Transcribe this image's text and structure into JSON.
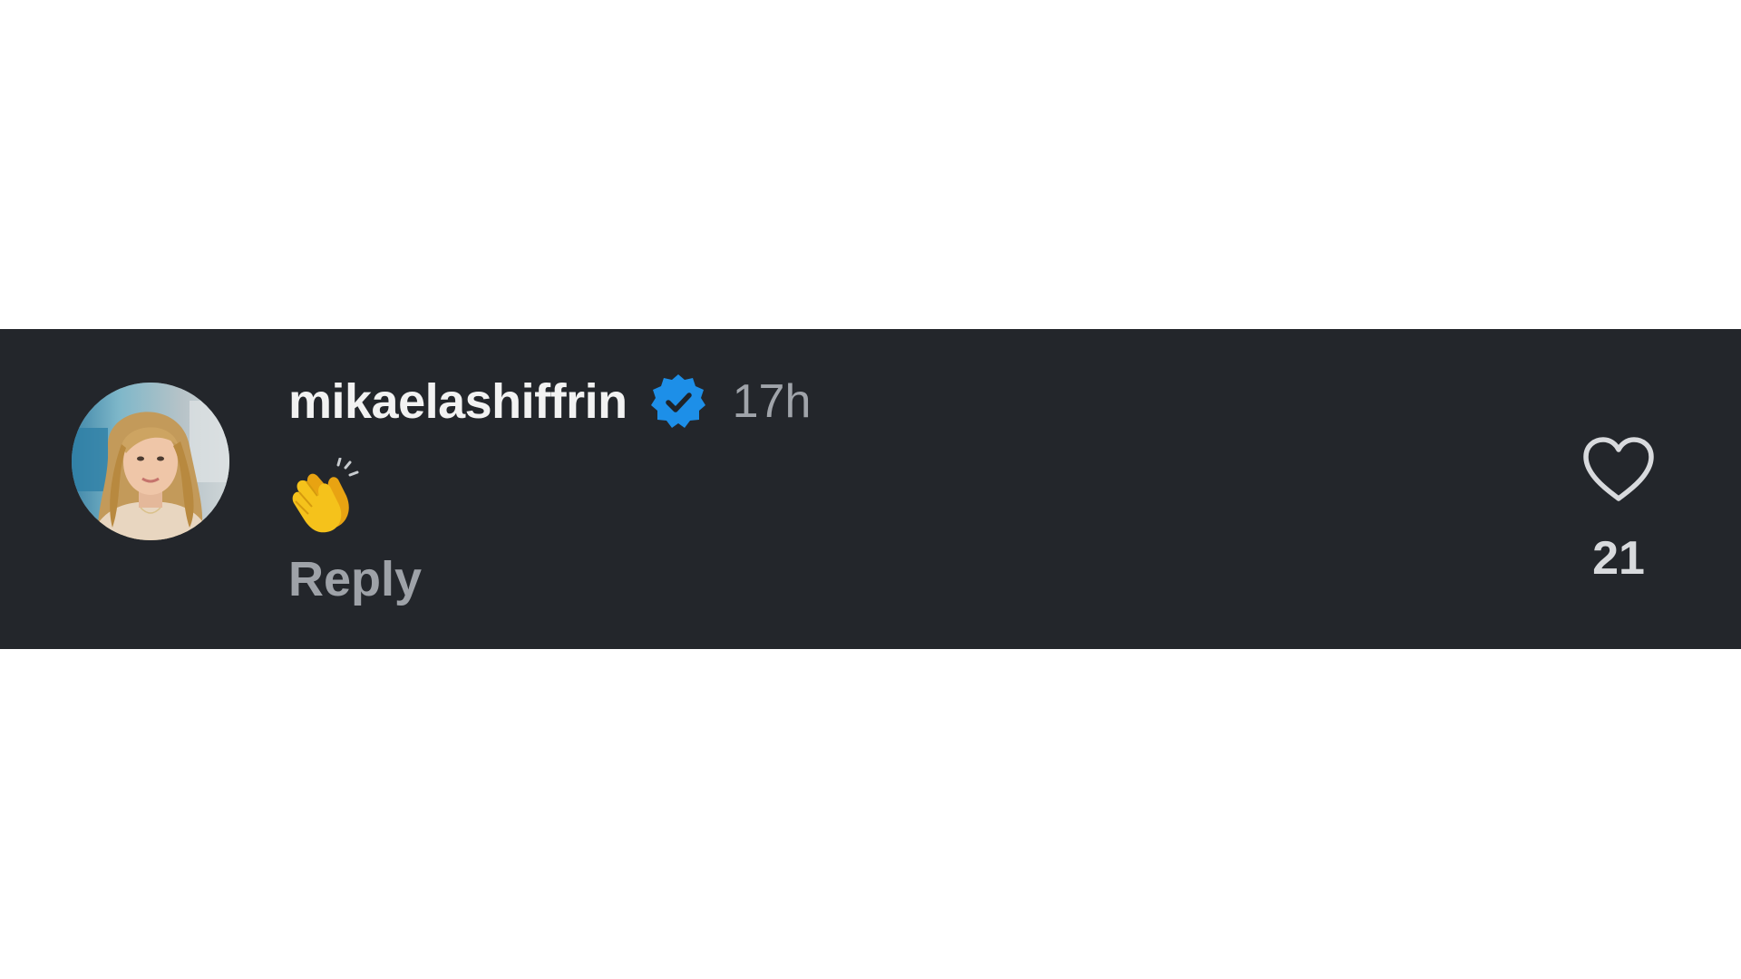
{
  "comment": {
    "username": "mikaelashiffrin",
    "verified": true,
    "verified_icon": "verified-badge-icon",
    "timestamp": "17h",
    "body": "👏",
    "body_icon": "clapping-hands-icon",
    "reply_label": "Reply",
    "like_icon": "heart-outline-icon",
    "like_count": "21"
  },
  "colors": {
    "background": "#23262b",
    "username": "#f2f2f2",
    "timestamp": "#a0a4aa",
    "reply": "#9ea2a8",
    "verified": "#1d8fe8"
  }
}
